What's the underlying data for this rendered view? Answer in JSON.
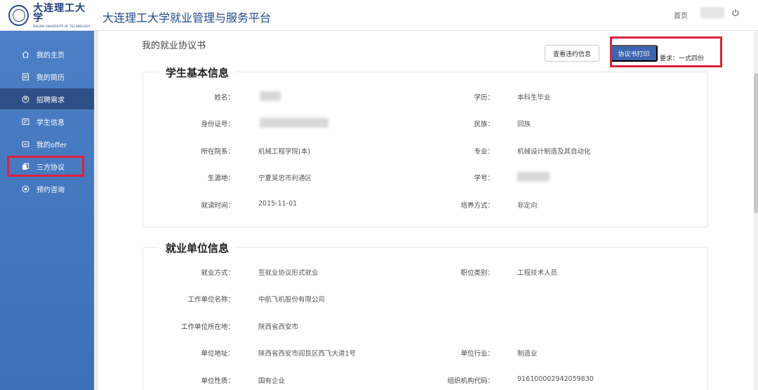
{
  "header": {
    "logo_cn": "大连理工大学",
    "logo_en": "DALIAN UNIVERSITY OF TECHNOLOGY",
    "title": "大连理工大学就业管理与服务平台",
    "home_label": "首页"
  },
  "sidebar": {
    "items": [
      {
        "label": "我的主页",
        "icon": "home-icon"
      },
      {
        "label": "我的简历",
        "icon": "resume-icon"
      },
      {
        "label": "招聘需求",
        "icon": "recruit-icon"
      },
      {
        "label": "学生信息",
        "icon": "student-info-icon"
      },
      {
        "label": "我的offer",
        "icon": "offer-icon"
      },
      {
        "label": "三方协议",
        "icon": "agreement-icon"
      },
      {
        "label": "预约咨询",
        "icon": "consult-icon"
      }
    ],
    "active_index": 2,
    "highlighted_index": 5
  },
  "main": {
    "page_title": "我的就业协议书",
    "view_violation_label": "查看违约信息",
    "print_label": "协议书打印",
    "print_note": "要求：一式四份"
  },
  "student_section": {
    "title": "学生基本信息",
    "left": [
      {
        "label": "姓名：",
        "value": ""
      },
      {
        "label": "身份证号：",
        "value": ""
      },
      {
        "label": "所在院系：",
        "value": "机械工程学院(本)"
      },
      {
        "label": "生源地：",
        "value": "宁夏吴忠市利通区"
      },
      {
        "label": "就读时间：",
        "value": "2015-11-01"
      }
    ],
    "right": [
      {
        "label": "学历：",
        "value": "本科生毕业"
      },
      {
        "label": "民族：",
        "value": "回族"
      },
      {
        "label": "专业：",
        "value": "机械设计制造及其自动化"
      },
      {
        "label": "学号：",
        "value": ""
      },
      {
        "label": "培养方式：",
        "value": "非定向"
      }
    ]
  },
  "employer_section": {
    "title": "就业单位信息",
    "left": [
      {
        "label": "就业方式：",
        "value": "签就业协议形式就业"
      },
      {
        "label": "工作单位名称：",
        "value": "中航飞机股份有限公司"
      },
      {
        "label": "工作单位所在地：",
        "value": "陕西省西安市"
      },
      {
        "label": "单位地址：",
        "value": "陕西省西安市阎良区西飞大道1号"
      },
      {
        "label": "单位性质：",
        "value": "国有企业"
      }
    ],
    "right": [
      {
        "label": "职位类别：",
        "value": "工程技术人员"
      },
      {
        "label": "单位行业：",
        "value": "制造业"
      },
      {
        "label": "组织机构代码：",
        "value": "916100002942059830"
      }
    ]
  },
  "colors": {
    "sidebar": "#4a7bc4",
    "sidebar_active": "#2e4f86",
    "highlight": "#e0203a",
    "primary_button": "#3c64b0",
    "title": "#234a8c"
  }
}
